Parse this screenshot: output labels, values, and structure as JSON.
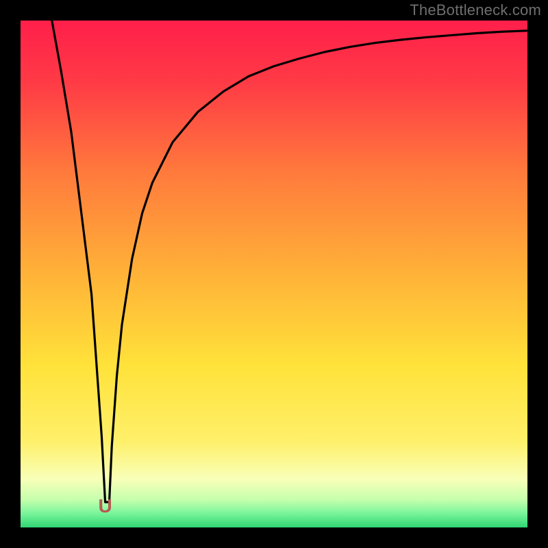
{
  "watermark": "TheBottleneck.com",
  "marker": {
    "glyph": "U",
    "x_pct": 0.167,
    "y_pct": 0.958
  },
  "colors": {
    "top": "#ff1f4a",
    "orange": "#ff7a3c",
    "yellow": "#ffe23a",
    "pale": "#f8ffb8",
    "green": "#41e07a",
    "frame": "#000000",
    "curve": "#000000",
    "marker": "#b35b53",
    "watermark": "#6f6f6f"
  },
  "chart_data": {
    "type": "line",
    "title": "",
    "xlabel": "",
    "ylabel": "",
    "xlim": [
      0,
      100
    ],
    "ylim": [
      0,
      100
    ],
    "x": [
      6,
      8,
      10,
      12,
      14,
      15,
      16,
      16.7,
      17.5,
      18,
      19,
      20,
      22,
      24,
      26,
      30,
      35,
      40,
      45,
      50,
      55,
      60,
      65,
      70,
      75,
      80,
      85,
      90,
      95,
      100
    ],
    "values": [
      101,
      90,
      78,
      62,
      46,
      32,
      18,
      5,
      5,
      16,
      30,
      40,
      53,
      62,
      68,
      76,
      82,
      86,
      89,
      91,
      92.5,
      93.8,
      94.8,
      95.6,
      96.2,
      96.7,
      97.1,
      97.5,
      97.8,
      98
    ],
    "notes": "Single black curve on a vertical red→green gradient background. Values are approximate readings from pixel positions; the curve dips to a minimum near x≈16.7 (marked with a small 'U' glyph) and asymptotically approaches ~98 on the right."
  }
}
